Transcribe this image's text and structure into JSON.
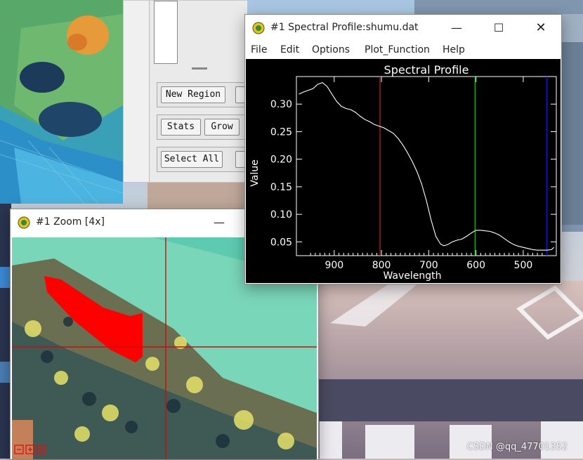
{
  "roi_tool": {
    "new_region_label": "New Region",
    "stats_label": "Stats",
    "grow_label": "Grow",
    "select_all_label": "Select All"
  },
  "spectral_window": {
    "title": "#1 Spectral Profile:shumu.dat",
    "menu": [
      "File",
      "Edit",
      "Options",
      "Plot_Function",
      "Help"
    ]
  },
  "zoom_window": {
    "title": "#1 Zoom [4x]"
  },
  "watermark": "CSDN @qq_47701352",
  "chart_data": {
    "type": "line",
    "title": "Spectral Profile",
    "xlabel": "Wavelength",
    "ylabel": "Value",
    "xlim": [
      980,
      430
    ],
    "ylim": [
      0.025,
      0.35
    ],
    "xticks": [
      900,
      800,
      700,
      600,
      500
    ],
    "yticks": [
      0.3,
      0.25,
      0.2,
      0.15,
      0.1,
      0.05
    ],
    "band_markers": [
      {
        "x": 803,
        "color": "#d02020"
      },
      {
        "x": 602,
        "color": "#20c020"
      },
      {
        "x": 450,
        "color": "#1020d0"
      }
    ],
    "series": [
      {
        "color": "#ffffff",
        "x": [
          975,
          965,
          955,
          945,
          935,
          925,
          915,
          905,
          895,
          885,
          875,
          865,
          855,
          845,
          835,
          825,
          815,
          805,
          795,
          785,
          775,
          765,
          755,
          745,
          735,
          725,
          715,
          705,
          695,
          685,
          675,
          668,
          660,
          650,
          640,
          630,
          620,
          610,
          600,
          590,
          580,
          570,
          560,
          550,
          540,
          530,
          520,
          510,
          500,
          490,
          480,
          470,
          460,
          450,
          440,
          435
        ],
        "values": [
          0.318,
          0.322,
          0.325,
          0.328,
          0.336,
          0.339,
          0.332,
          0.318,
          0.305,
          0.296,
          0.292,
          0.29,
          0.285,
          0.278,
          0.272,
          0.268,
          0.263,
          0.26,
          0.257,
          0.252,
          0.247,
          0.238,
          0.226,
          0.212,
          0.196,
          0.178,
          0.155,
          0.125,
          0.09,
          0.06,
          0.046,
          0.043,
          0.045,
          0.05,
          0.053,
          0.055,
          0.06,
          0.066,
          0.071,
          0.071,
          0.07,
          0.069,
          0.066,
          0.062,
          0.056,
          0.05,
          0.045,
          0.042,
          0.04,
          0.038,
          0.036,
          0.035,
          0.035,
          0.035,
          0.036,
          0.04
        ]
      }
    ]
  }
}
